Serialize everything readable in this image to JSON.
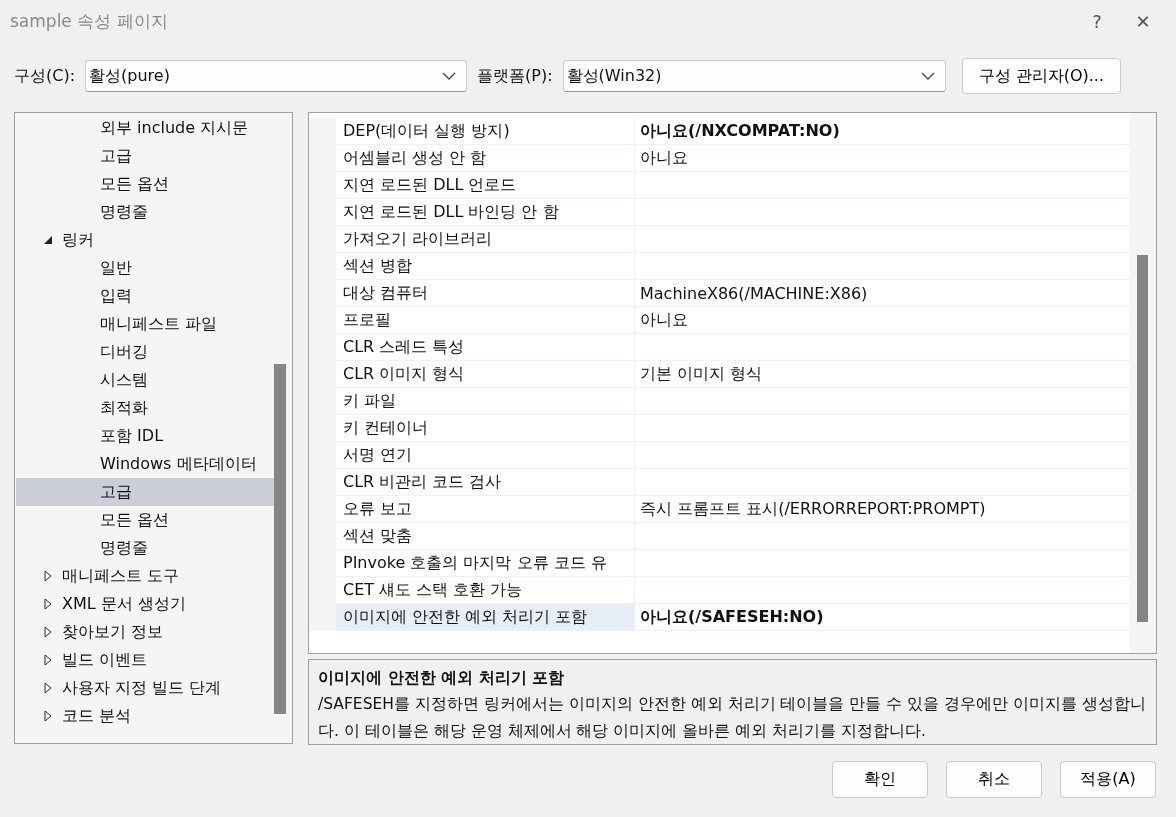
{
  "window": {
    "title": "sample 속성 페이지",
    "help": "?",
    "close": "✕"
  },
  "config_bar": {
    "configuration": {
      "label": "구성(C):",
      "value": "활성(pure)"
    },
    "platform": {
      "label": "플랫폼(P):",
      "value": "활성(Win32)"
    },
    "manager_button": "구성 관리자(O)..."
  },
  "tree": [
    {
      "children": [
        {
          "label": "외부 include 지시문",
          "selected": false
        },
        {
          "label": "고급",
          "selected": false
        },
        {
          "label": "모든 옵션",
          "selected": false
        },
        {
          "label": "명령줄",
          "selected": false
        }
      ]
    },
    {
      "label": "링커",
      "expanded": true,
      "selected": false,
      "children": [
        {
          "label": "일반",
          "selected": false
        },
        {
          "label": "입력",
          "selected": false
        },
        {
          "label": "매니페스트 파일",
          "selected": false
        },
        {
          "label": "디버깅",
          "selected": false
        },
        {
          "label": "시스템",
          "selected": false
        },
        {
          "label": "최적화",
          "selected": false
        },
        {
          "label": "포함 IDL",
          "selected": false
        },
        {
          "label": "Windows 메타데이터",
          "selected": false
        },
        {
          "label": "고급",
          "selected": true
        },
        {
          "label": "모든 옵션",
          "selected": false
        },
        {
          "label": "명령줄",
          "selected": false
        }
      ]
    },
    {
      "label": "매니페스트 도구",
      "expanded": false,
      "selected": false
    },
    {
      "label": "XML 문서 생성기",
      "expanded": false,
      "selected": false
    },
    {
      "label": "찾아보기 정보",
      "expanded": false,
      "selected": false
    },
    {
      "label": "빌드 이벤트",
      "expanded": false,
      "selected": false
    },
    {
      "label": "사용자 지정 빌드 단계",
      "expanded": false,
      "selected": false
    },
    {
      "label": "코드 분석",
      "expanded": false,
      "selected": false
    }
  ],
  "properties": [
    {
      "name": "DEP(데이터 실행 방지)",
      "value": "아니요(/NXCOMPAT:NO)",
      "modified": true,
      "selected": false
    },
    {
      "name": "어셈블리 생성 안 함",
      "value": "아니요",
      "modified": false,
      "selected": false
    },
    {
      "name": "지연 로드된 DLL 언로드",
      "selected": false
    },
    {
      "name": "지연 로드된 DLL 바인딩 안 함",
      "selected": false
    },
    {
      "name": "가져오기 라이브러리",
      "selected": false
    },
    {
      "name": "섹션 병합",
      "selected": false
    },
    {
      "name": "대상 컴퓨터",
      "value": "MachineX86(/MACHINE:X86)",
      "modified": false,
      "selected": false
    },
    {
      "name": "프로필",
      "value": "아니요",
      "modified": false,
      "selected": false
    },
    {
      "name": "CLR 스레드 특성",
      "selected": false
    },
    {
      "name": "CLR 이미지 형식",
      "value": "기본 이미지 형식",
      "modified": false,
      "selected": false
    },
    {
      "name": "키 파일",
      "selected": false
    },
    {
      "name": "키 컨테이너",
      "selected": false
    },
    {
      "name": "서명 연기",
      "selected": false
    },
    {
      "name": "CLR 비관리 코드 검사",
      "selected": false
    },
    {
      "name": "오류 보고",
      "value": "즉시 프롬프트 표시(/ERRORREPORT:PROMPT)",
      "modified": false,
      "selected": false
    },
    {
      "name": "섹션 맞춤",
      "selected": false
    },
    {
      "name": "PInvoke 호출의 마지막 오류 코드 유",
      "selected": false
    },
    {
      "name": "CET 섀도 스택 호환 가능",
      "selected": false
    },
    {
      "name": "이미지에 안전한 예외 처리기 포함",
      "value": "아니요(/SAFESEH:NO)",
      "modified": true,
      "selected": true
    }
  ],
  "description": {
    "title": "이미지에 안전한 예외 처리기 포함",
    "text": "/SAFESEH를 지정하면 링커에서는 이미지의 안전한 예외 처리기 테이블을 만들 수 있을 경우에만 이미지를 생성합니다. 이 테이블은 해당 운영 체제에서 해당 이미지에 올바른 예외 처리기를 지정합니다."
  },
  "buttons": [
    "확인",
    "취소",
    "적용(A)"
  ]
}
